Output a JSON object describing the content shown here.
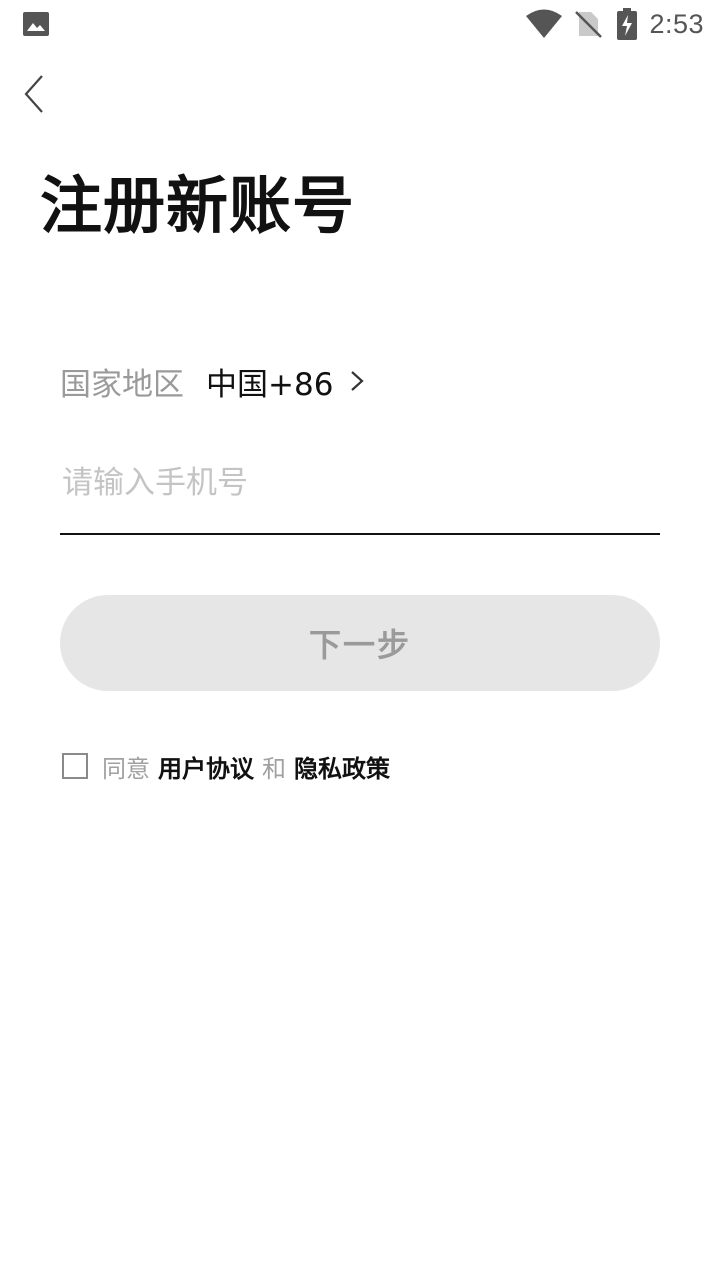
{
  "status_bar": {
    "time": "2:53",
    "icons": [
      "image-icon",
      "wifi-icon",
      "no-sim-icon",
      "battery-charging-icon"
    ]
  },
  "header": {
    "back_icon": "back-chevron-icon",
    "title": "注册新账号"
  },
  "country": {
    "label": "国家地区",
    "value": "中国+86",
    "chevron": "chevron-right-icon"
  },
  "phone": {
    "placeholder": "请输入手机号",
    "value": ""
  },
  "next_button": {
    "label": "下一步"
  },
  "agreement": {
    "prefix": "同意",
    "terms": "用户协议",
    "conjunction": "和",
    "privacy": "隐私政策",
    "checked": false
  },
  "colors": {
    "text_primary": "#111111",
    "text_secondary": "#9a9a9a",
    "placeholder": "#c4c4c4",
    "button_disabled_bg": "#e6e6e6"
  }
}
